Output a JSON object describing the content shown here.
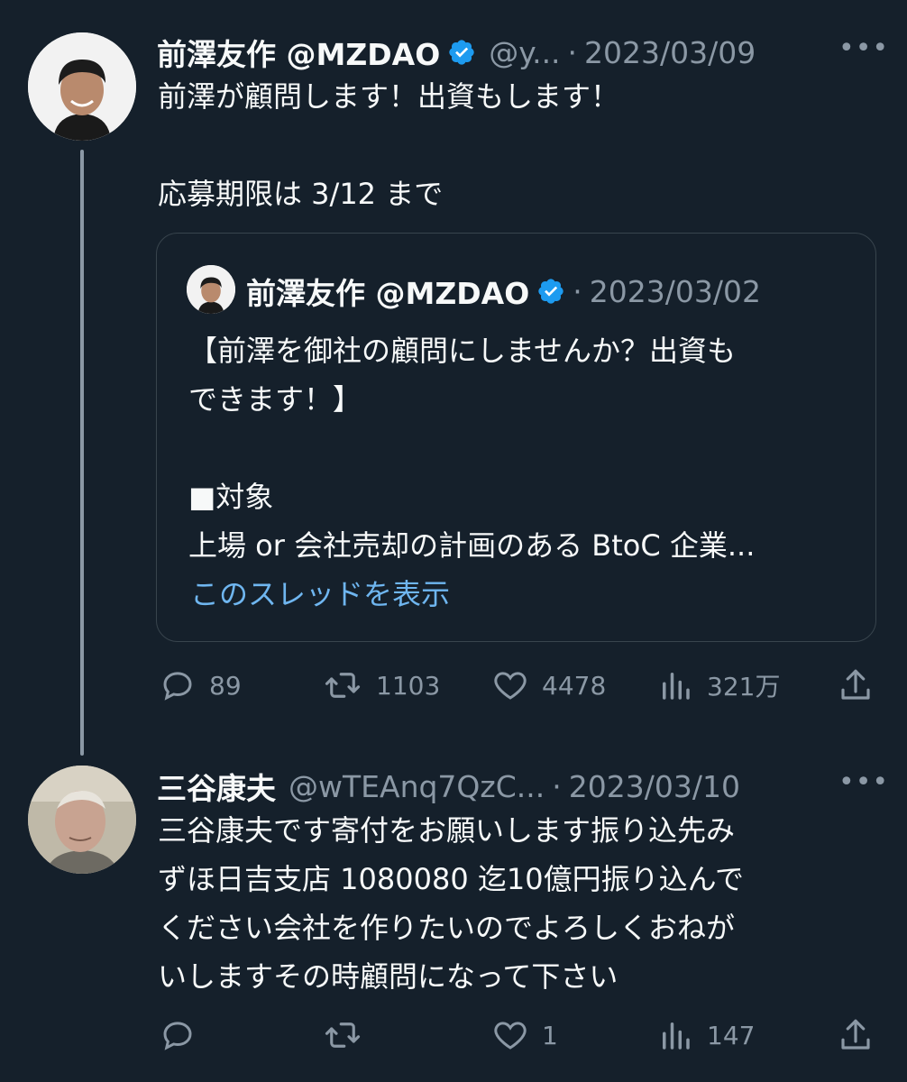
{
  "tweet1": {
    "name": "前澤友作 @MZDAO",
    "handle": "@y...",
    "sep": "·",
    "date": "2023/03/09",
    "more": "•••",
    "text": "前澤が顧問します！出資もします！\n\n応募期限は 3/12 まで",
    "quote": {
      "name": "前澤友作 @MZDAO",
      "sep": "·",
      "date": "2023/03/02",
      "text": "【前澤を御社の顧問にしませんか？出資も\nできます！】\n\n■対象\n上場 or 会社売却の計画のある BtoC 企業...",
      "show_thread": "このスレッドを表示"
    },
    "actions": {
      "replies": "89",
      "retweets": "1103",
      "likes": "4478",
      "views": "321万"
    }
  },
  "tweet2": {
    "name": "三谷康夫",
    "handle": "@wTEAnq7QzC...",
    "sep": "·",
    "date": "2023/03/10",
    "more": "•••",
    "text": "三谷康夫です寄付をお願いします振り込先み\nずほ日吉支店 1080080 迄10億円振り込んで\nください会社を作りたいのでよろしくおねが\nいしますその時顧問になって下さい",
    "actions": {
      "replies": "",
      "retweets": "",
      "likes": "1",
      "views": "147"
    }
  },
  "colors": {
    "background": "#15202b",
    "muted": "#8b98a5",
    "verified": "#1d9bf0",
    "link": "#6fb6f0"
  }
}
